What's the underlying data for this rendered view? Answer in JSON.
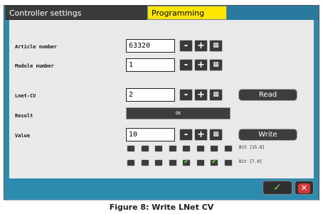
{
  "tabs": {
    "inactive": "Controller settings",
    "active": "Programming"
  },
  "rows": {
    "article": {
      "label": "Article number",
      "value": "63320"
    },
    "module": {
      "label": "Module number",
      "value": "1"
    },
    "lnet": {
      "label": "Lnet-CV",
      "value": "2"
    },
    "result": {
      "label": "Result",
      "value": "OK"
    },
    "value": {
      "label": "Value",
      "value": "10"
    }
  },
  "buttons": {
    "minus": "-",
    "plus": "+",
    "keypad": "▦",
    "read": "Read",
    "write": "Write",
    "ok": "✓",
    "cancel": "✕"
  },
  "bits": {
    "high_label": "Bit [15.8]",
    "low_label": "Bit [7.0]",
    "high": [
      false,
      false,
      false,
      false,
      false,
      false,
      false,
      false
    ],
    "low": [
      false,
      false,
      false,
      false,
      true,
      false,
      true,
      false
    ]
  },
  "caption": "Figure 8: Write LNet CV",
  "colors": {
    "accent": "#ffe600",
    "frame": "#2e8bb0",
    "panel": "#e9e9e9"
  }
}
